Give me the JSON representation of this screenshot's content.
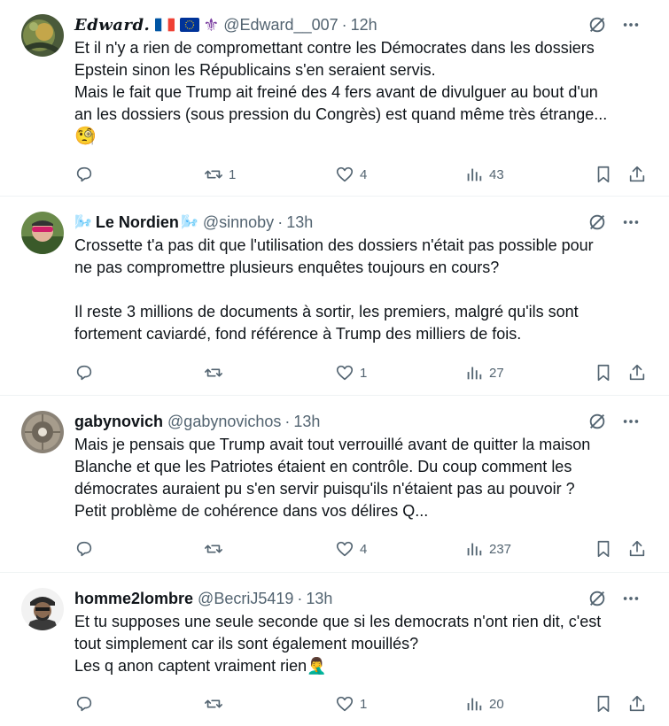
{
  "tweets": [
    {
      "name": "Edward.",
      "name_emojis": "🇫🇷🇪🇺⚜️",
      "handle": "@Edward__007",
      "time": "12h",
      "lines": [
        "Et il n'y a rien de compromettant contre les Démocrates dans les dossiers",
        "Epstein sinon les Républicains s'en seraient servis.",
        "Mais le fait que Trump ait freiné des 4 fers avant de divulguer au bout d'un",
        "an les dossiers (sous pression du Congrès) est quand même très étrange...",
        "🧐"
      ],
      "replies": "",
      "reposts": "1",
      "likes": "4",
      "views": "43"
    },
    {
      "name": "Le Nordien",
      "name_prefix": "🌬️",
      "name_suffix": "🌬️",
      "handle": "@sinnoby",
      "time": "13h",
      "lines": [
        "Crossette t'a pas dit que l'utilisation des dossiers n'était pas possible pour",
        "ne pas compromettre plusieurs enquêtes toujours en cours?",
        "",
        "Il reste 3 millions de documents à sortir, les premiers, malgré qu'ils sont",
        "fortement caviardé, fond référence à Trump  des milliers de fois."
      ],
      "replies": "",
      "reposts": "",
      "likes": "1",
      "views": "27"
    },
    {
      "name": "gabynovich",
      "handle": "@gabynovichos",
      "time": "13h",
      "lines": [
        "Mais je pensais que Trump avait tout verrouillé avant de quitter la maison",
        "Blanche et que les Patriotes étaient en contrôle. Du coup comment les",
        "démocrates auraient pu s'en servir puisqu'ils n'étaient pas au pouvoir ?",
        "Petit problème de cohérence dans vos délires Q..."
      ],
      "replies": "",
      "reposts": "",
      "likes": "4",
      "views": "237"
    },
    {
      "name": "homme2lombre",
      "handle": "@BecriJ5419",
      "time": "13h",
      "lines": [
        "Et tu supposes une seule seconde que si les democrats n'ont rien dit, c'est",
        "tout simplement car ils sont également mouillés?",
        "Les q anon captent vraiment rien🤦‍♂️"
      ],
      "replies": "",
      "reposts": "",
      "likes": "1",
      "views": "20"
    }
  ],
  "dot": "·",
  "colors": {
    "text": "#0f1419",
    "secondary": "#536471",
    "border": "#eff3f4",
    "grok": "#536471"
  }
}
